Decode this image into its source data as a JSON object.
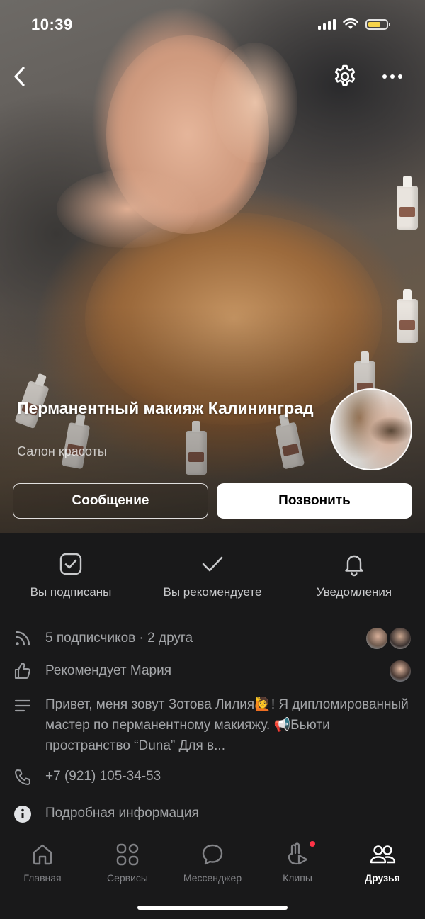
{
  "status_bar": {
    "time": "10:39",
    "battery_color": "#f6d34a"
  },
  "header": {
    "back_icon": "chevron-left-icon",
    "settings_icon": "gear-icon",
    "more_icon": "more-horizontal-icon"
  },
  "profile": {
    "name": "Перманентный макияж Калининград",
    "type": "Салон красоты",
    "message_button": "Сообщение",
    "call_button": "Позвонить"
  },
  "actions": [
    {
      "icon": "checkbox-icon",
      "label": "Вы подписаны"
    },
    {
      "icon": "check-icon",
      "label": "Вы рекомендуете"
    },
    {
      "icon": "bell-icon",
      "label": "Уведомления"
    }
  ],
  "info": {
    "followers": "5 подписчиков · 2 друга",
    "recommends": "Рекомендует Мария",
    "about": "Привет, меня зовут Зотова Лилия🙋! Я дипломированный мастер по перманентному макияжу. 📢Бьюти пространство “Duna”  Для в...",
    "phone": "+7 (921) 105-34-53",
    "details": "Подробная информация"
  },
  "tabs": [
    {
      "icon": "home-icon",
      "label": "Главная"
    },
    {
      "icon": "services-icon",
      "label": "Сервисы"
    },
    {
      "icon": "messenger-icon",
      "label": "Мессенджер"
    },
    {
      "icon": "clips-icon",
      "label": "Клипы"
    },
    {
      "icon": "friends-icon",
      "label": "Друзья"
    }
  ],
  "colors": {
    "background": "#19191a",
    "link": "#71aaeb",
    "notification_dot": "#ff3347"
  }
}
